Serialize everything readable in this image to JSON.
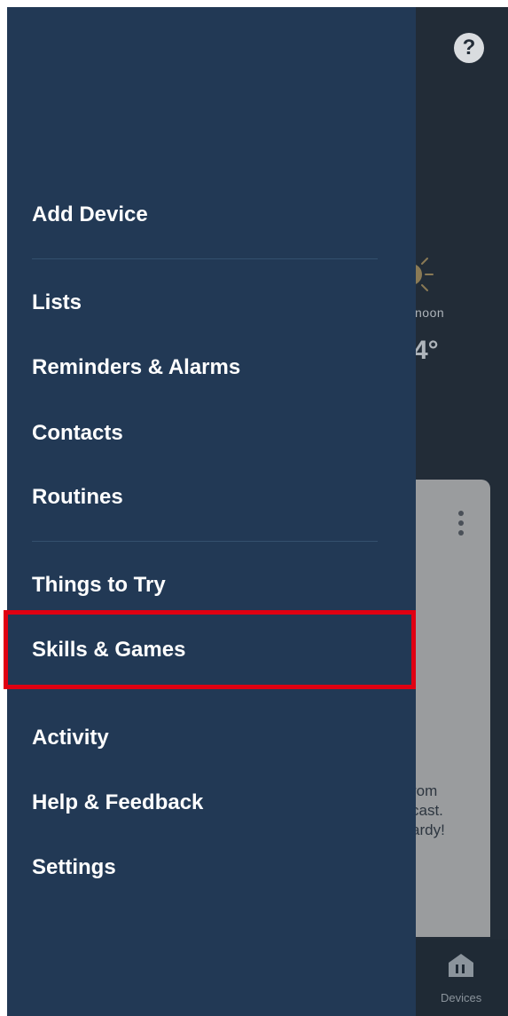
{
  "background_app": {
    "help_icon_glyph": "?",
    "weather": {
      "time_label": "noon",
      "temperature": "4°"
    },
    "card_text_lines": [
      "rom",
      "cast.",
      "ardy!"
    ],
    "bottom_nav": {
      "devices_label": "Devices"
    }
  },
  "drawer": {
    "groups": [
      {
        "items": [
          {
            "label": "Add Device"
          }
        ]
      },
      {
        "items": [
          {
            "label": "Lists"
          },
          {
            "label": "Reminders & Alarms"
          },
          {
            "label": "Contacts"
          },
          {
            "label": "Routines"
          }
        ]
      },
      {
        "items": [
          {
            "label": "Things to Try"
          },
          {
            "label": "Skills & Games",
            "highlighted": true
          },
          {
            "label": "Activity"
          },
          {
            "label": "Help & Feedback"
          },
          {
            "label": "Settings"
          }
        ]
      }
    ]
  },
  "colors": {
    "drawer_bg": "#223955",
    "app_bg": "#222c37",
    "highlight_border": "#e00012",
    "text": "#ffffff"
  }
}
